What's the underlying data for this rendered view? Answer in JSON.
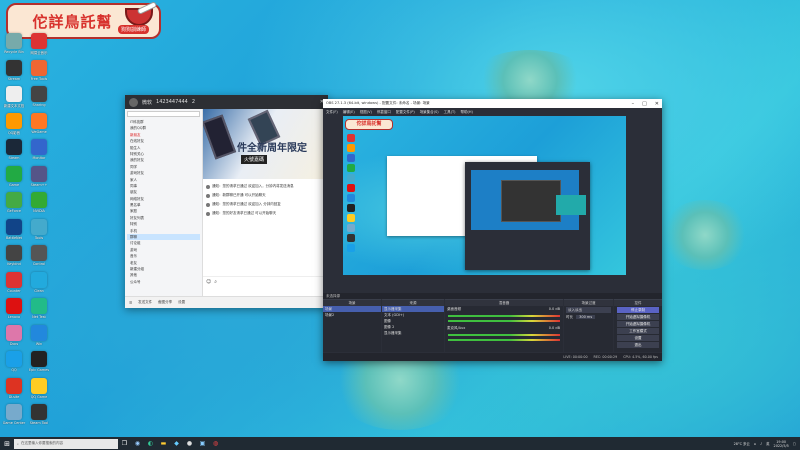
{
  "banner": {
    "title": "佗詳鳥託幫",
    "subtitle": "狗狗訓練師"
  },
  "desktop_icons": [
    {
      "label": "Recycle Bin",
      "color": "#7aa"
    },
    {
      "label": "网易云音乐",
      "color": "#d33"
    },
    {
      "label": "Stream",
      "color": "#333"
    },
    {
      "label": "Free Tools",
      "color": "#e63"
    },
    {
      "label": "新建文本文档",
      "color": "#eee"
    },
    {
      "label": "Sharing",
      "color": "#444"
    },
    {
      "label": "QQ影音",
      "color": "#f90"
    },
    {
      "label": "WeGame",
      "color": "#f72"
    },
    {
      "label": "Steam",
      "color": "#1b2838"
    },
    {
      "label": "Monitor",
      "color": "#36c"
    },
    {
      "label": "Game",
      "color": "#2a4"
    },
    {
      "label": "Steam++",
      "color": "#558"
    },
    {
      "label": "GeForce",
      "color": "#4a4"
    },
    {
      "label": "NVIDIA",
      "color": "#3a3"
    },
    {
      "label": "BattleNet",
      "color": "#148"
    },
    {
      "label": "Tools",
      "color": "#4ac"
    },
    {
      "label": "Keybind",
      "color": "#444"
    },
    {
      "label": "Control",
      "color": "#555"
    },
    {
      "label": "Counter",
      "color": "#d33"
    },
    {
      "label": "Clean",
      "color": "#2ad"
    },
    {
      "label": "Lenovo",
      "color": "#d11"
    },
    {
      "label": "Net Test",
      "color": "#2b8"
    },
    {
      "label": "Docs",
      "color": "#d7a"
    },
    {
      "label": "Win",
      "color": "#28d"
    },
    {
      "label": "QQ",
      "color": "#1aa0e8"
    },
    {
      "label": "Epic Games",
      "color": "#222"
    },
    {
      "label": "DLsite",
      "color": "#d32"
    },
    {
      "label": "QQ Game",
      "color": "#fc2"
    },
    {
      "label": "Game Center",
      "color": "#7ac"
    },
    {
      "label": "Steam Tool",
      "color": "#333"
    }
  ],
  "qq": {
    "top_name": "微软",
    "top_number": "1423447444",
    "top_extra": "2",
    "search_hint": "",
    "tree": [
      {
        "label": "IT科技群",
        "state": "normal"
      },
      {
        "label": "我的QQ群",
        "state": "normal"
      },
      {
        "label": "新朋友",
        "state": "red"
      },
      {
        "label": "在线好友",
        "state": "normal"
      },
      {
        "label": "陌生人",
        "state": "normal"
      },
      {
        "label": "特别关心",
        "state": "normal"
      },
      {
        "label": "我的好友",
        "state": "normal"
      },
      {
        "label": "同学",
        "state": "normal"
      },
      {
        "label": "游戏好友",
        "state": "normal"
      },
      {
        "label": "家人",
        "state": "normal"
      },
      {
        "label": "同事",
        "state": "normal"
      },
      {
        "label": "朋友",
        "state": "normal"
      },
      {
        "label": "网络好友",
        "state": "normal"
      },
      {
        "label": "黑名单",
        "state": "normal"
      },
      {
        "label": "家庭",
        "state": "normal"
      },
      {
        "label": "好友列表",
        "state": "normal"
      },
      {
        "label": "特别",
        "state": "normal"
      },
      {
        "label": "手机",
        "state": "normal"
      },
      {
        "label": "群聊",
        "state": "active"
      },
      {
        "label": "讨论组",
        "state": "normal"
      },
      {
        "label": "游戏",
        "state": "normal"
      },
      {
        "label": "音乐",
        "state": "normal"
      },
      {
        "label": "老友",
        "state": "normal"
      },
      {
        "label": "新建分组",
        "state": "normal"
      },
      {
        "label": "其他",
        "state": "normal"
      },
      {
        "label": "公众号",
        "state": "normal"
      }
    ],
    "ad_line1": "件全新周年限定",
    "ad_line2": "火號嘉碼",
    "messages": [
      "通知：您的请求已通过 欢迎加入，分钟内将发送消息",
      "通知：新群聊已开通 可以开始聊天",
      "通知：您的请求已通过 欢迎加入 分钟内回复",
      "通知：您的好友请求已通过 可以开始聊天"
    ],
    "footer": [
      "发送文件",
      "截图分享",
      "设置"
    ]
  },
  "obs": {
    "title": "OBS 27.1.3 (64-bit, windows) - 配置文件: 未命名 - 场景: 场景",
    "menu": [
      "文件(F)",
      "编辑(E)",
      "视图(V)",
      "停靠窗口",
      "配置文件(P)",
      "场景集合(S)",
      "工具(T)",
      "帮助(H)"
    ],
    "banner_text": "佗詳鳥託幫",
    "mid_label": "未选择源",
    "docks": {
      "scenes": {
        "title": "场景",
        "items": [
          "场景",
          "场景2"
        ]
      },
      "sources": {
        "title": "来源",
        "items": [
          "显示器采集",
          "文本 (GDI+)",
          "图像",
          "图像 2",
          "显示器采集"
        ]
      },
      "mixer": {
        "title": "混音器",
        "channels": [
          "桌面音频",
          "麦克风/Aux"
        ],
        "db": [
          "0.0 dB",
          "0.0 dB"
        ]
      },
      "transitions": {
        "title": "场景过渡",
        "type": "淡入淡出",
        "duration_label": "时长",
        "duration": "300 ms"
      },
      "controls": {
        "title": "控件",
        "buttons": [
          "停止录制",
          "开始虚拟摄像机",
          "开始虚拟摄像机",
          "工作室模式",
          "设置",
          "退出"
        ]
      }
    },
    "status": [
      "LIVE: 00:00:00",
      "REC: 00:00:29",
      "CPU: 4.5%, 60.00 fps"
    ]
  },
  "taskbar": {
    "search_placeholder": "在这里输入你要搜索的内容",
    "tray": [
      "28°C 多云",
      "英"
    ],
    "time": "19:00",
    "date": "2022/5/5"
  }
}
